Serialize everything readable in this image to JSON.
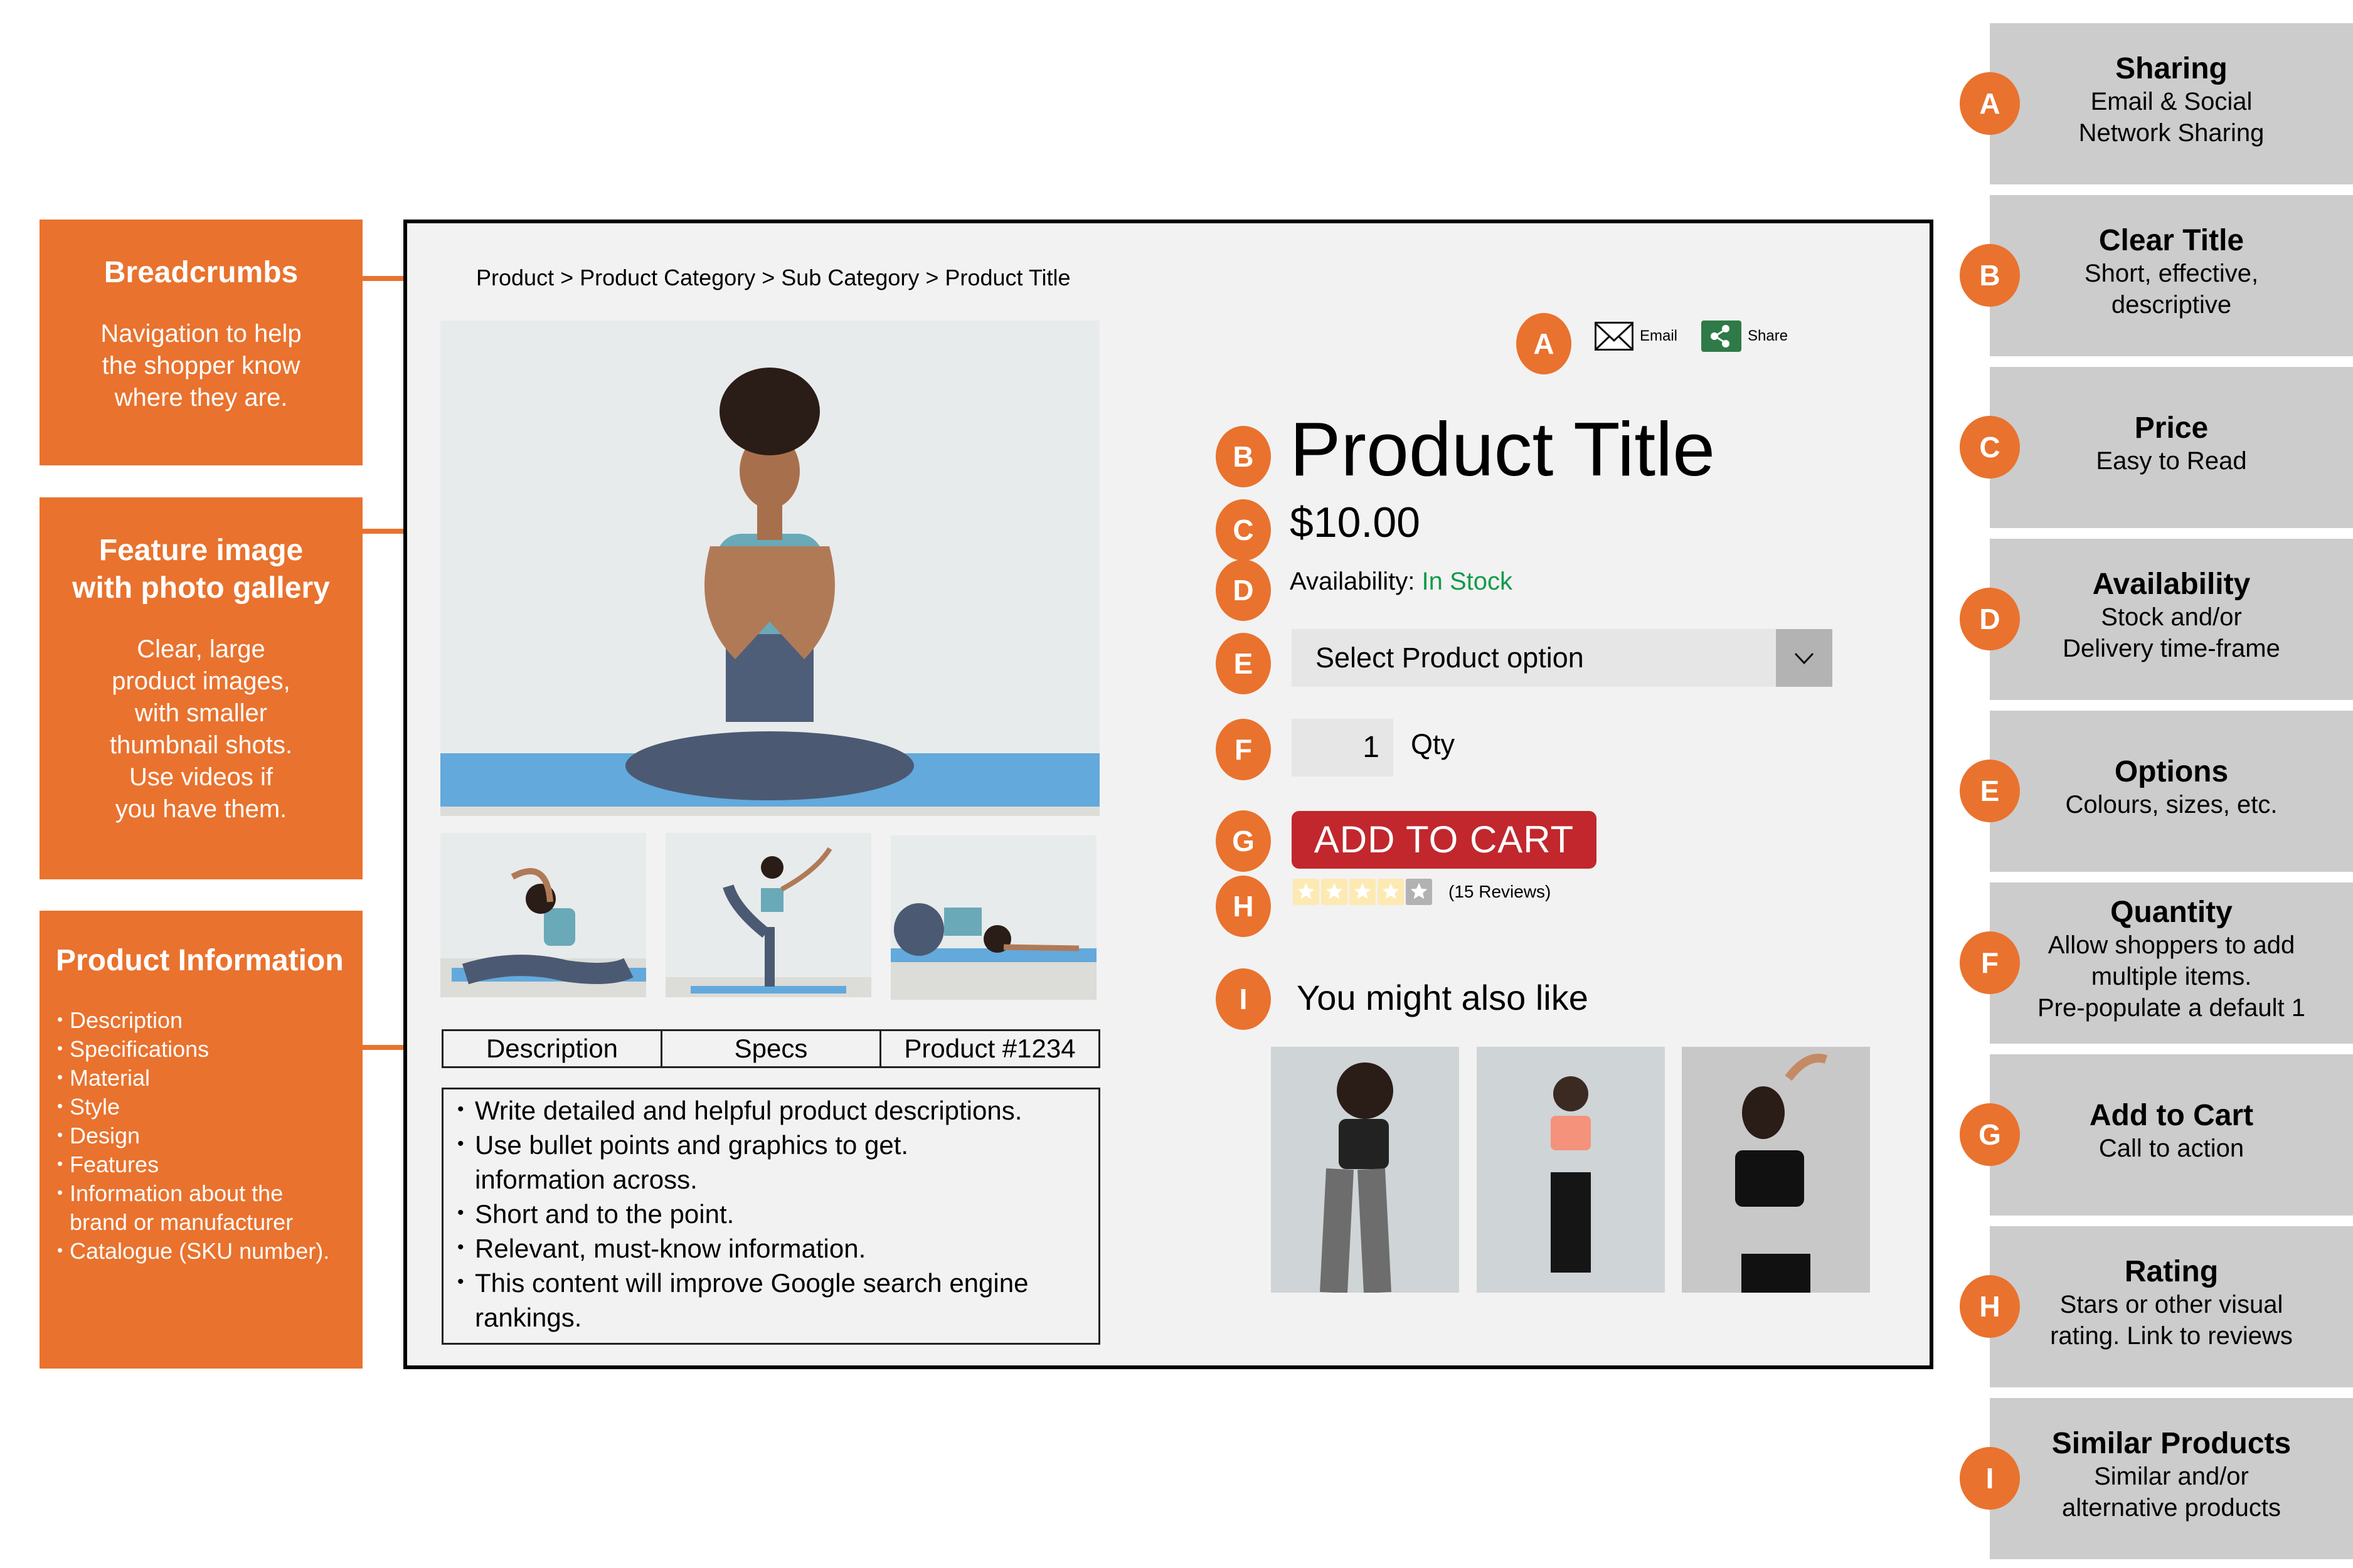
{
  "colors": {
    "accent_orange": "#e9722e",
    "card_grey": "#cccccc",
    "frame_bg": "#f2f2f2",
    "in_stock_green": "#139a4b",
    "cart_red": "#c1272d",
    "share_green": "#2f7a47",
    "star_filled": "#fde9b2",
    "star_empty": "#b2b2b2"
  },
  "left_callouts": {
    "breadcrumbs": {
      "title": "Breadcrumbs",
      "lines": [
        "Navigation to help",
        "the shopper know",
        "where they are."
      ]
    },
    "feature_image": {
      "title_lines": [
        "Feature image",
        "with photo gallery"
      ],
      "lines": [
        "Clear, large",
        "product images,",
        "with smaller",
        "thumbnail shots.",
        "Use videos if",
        "you have them."
      ]
    },
    "product_information": {
      "title": "Product Information",
      "items": [
        "Description",
        "Specifications",
        "Material",
        "Style",
        "Design",
        "Features",
        "Information about the brand or manufacturer",
        "Catalogue (SKU number)."
      ]
    }
  },
  "page": {
    "breadcrumb": "Product > Product Category > Sub Category > Product Title",
    "share": {
      "badge": "A",
      "email_label": "Email",
      "share_label": "Share",
      "email_icon": "envelope-icon",
      "share_icon": "share-nodes-icon"
    },
    "title": {
      "badge": "B",
      "text": "Product Title"
    },
    "price": {
      "badge": "C",
      "text": "$10.00"
    },
    "availability": {
      "badge": "D",
      "label": "Availability:",
      "status": "In Stock"
    },
    "options": {
      "badge": "E",
      "placeholder": "Select Product option",
      "icon": "chevron-down-icon"
    },
    "quantity": {
      "badge": "F",
      "value": "1",
      "label": "Qty"
    },
    "cart": {
      "badge": "G",
      "label": "ADD TO CART"
    },
    "rating": {
      "badge": "H",
      "stars_filled": 4,
      "stars_total": 5,
      "reviews_text": "(15 Reviews)"
    },
    "related": {
      "badge": "I",
      "heading": "You might also like",
      "count": 3
    },
    "tabs": [
      "Description",
      "Specs",
      "Product #1234"
    ],
    "description_bullets": [
      "Write detailed and helpful product descriptions.",
      "Use bullet points and graphics to get. information across.",
      "Short and to the point.",
      "Relevant, must-know information.",
      "This content will improve Google search engine rankings."
    ]
  },
  "right_cards": [
    {
      "badge": "A",
      "title": "Sharing",
      "lines": [
        "Email & Social",
        "Network Sharing"
      ]
    },
    {
      "badge": "B",
      "title": "Clear Title",
      "lines": [
        "Short, effective,",
        "descriptive"
      ]
    },
    {
      "badge": "C",
      "title": "Price",
      "lines": [
        "Easy to Read"
      ]
    },
    {
      "badge": "D",
      "title": "Availability",
      "lines": [
        "Stock and/or",
        "Delivery time-frame"
      ]
    },
    {
      "badge": "E",
      "title": "Options",
      "lines": [
        "Colours, sizes, etc."
      ]
    },
    {
      "badge": "F",
      "title": "Quantity",
      "lines": [
        "Allow shoppers to add",
        "multiple items.",
        "Pre-populate a default 1"
      ]
    },
    {
      "badge": "G",
      "title": "Add to Cart",
      "lines": [
        "Call to action"
      ]
    },
    {
      "badge": "H",
      "title": "Rating",
      "lines": [
        "Stars or other visual",
        "rating. Link to reviews"
      ]
    },
    {
      "badge": "I",
      "title": "Similar Products",
      "lines": [
        "Similar and/or",
        "alternative products"
      ]
    }
  ]
}
